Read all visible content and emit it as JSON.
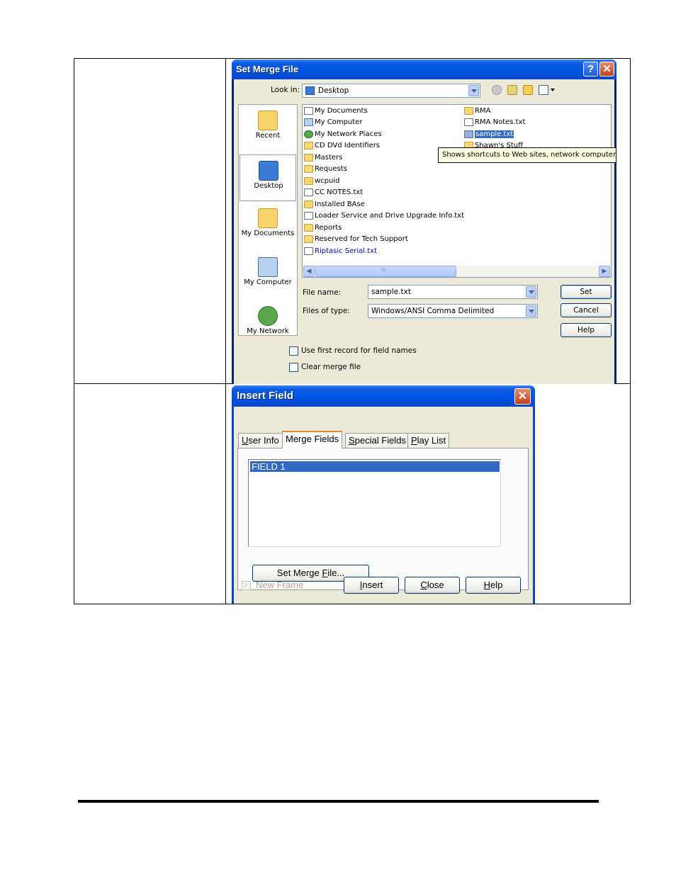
{
  "set_merge_file": {
    "title": "Set Merge File",
    "look_in_label": "Look in:",
    "look_in_value": "Desktop",
    "places": [
      {
        "label": "Recent",
        "icon": "recent-folder-icon"
      },
      {
        "label": "Desktop",
        "icon": "desktop-icon"
      },
      {
        "label": "My Documents",
        "icon": "my-documents-icon"
      },
      {
        "label": "My Computer",
        "icon": "my-computer-icon"
      },
      {
        "label": "My Network",
        "icon": "my-network-icon"
      }
    ],
    "files_col1": [
      {
        "name": "My Documents",
        "icon": "doc"
      },
      {
        "name": "My Computer",
        "icon": "pc"
      },
      {
        "name": "My Network Places",
        "icon": "net"
      },
      {
        "name": "CD DVd Identifiers",
        "icon": "folder"
      },
      {
        "name": "Masters",
        "icon": "folder"
      },
      {
        "name": "Requests",
        "icon": "folder"
      },
      {
        "name": "wcpuid",
        "icon": "folder"
      },
      {
        "name": "CC NOTES.txt",
        "icon": "doc"
      },
      {
        "name": "Installed BAse",
        "icon": "shortcut"
      },
      {
        "name": "Loader Service and Drive Upgrade Info.txt",
        "icon": "doc"
      },
      {
        "name": "Reports",
        "icon": "shortcut"
      },
      {
        "name": "Reserved for Tech Support",
        "icon": "shortcut"
      },
      {
        "name": "Riptasic Serial.txt",
        "icon": "doc"
      }
    ],
    "files_col2": [
      {
        "name": "RMA",
        "icon": "shortcut"
      },
      {
        "name": "RMA Notes.txt",
        "icon": "doc"
      },
      {
        "name": "sample.txt",
        "icon": "doc"
      },
      {
        "name": "Shawn's Stuff",
        "icon": "shortcut"
      }
    ],
    "tooltip": "Shows shortcuts to Web sites, network computers, ar",
    "file_name_label": "File name:",
    "file_name_value": "sample.txt",
    "files_of_type_label": "Files of type:",
    "files_of_type_value": "Windows/ANSI Comma Delimited",
    "buttons": {
      "set": "Set",
      "cancel": "Cancel",
      "help": "Help"
    },
    "scroll_glyph": "III",
    "options": {
      "use_first_record": "Use first record for field names",
      "clear_merge_file": "Clear merge file"
    }
  },
  "insert_field": {
    "title": "Insert Field",
    "tabs": [
      {
        "label": "User Info",
        "mnemonic": "U",
        "rest": "ser Info"
      },
      {
        "label": "Merge Fields",
        "mnemonic": "",
        "rest": "Merge Fields"
      },
      {
        "label": "Special Fields",
        "mnemonic": "S",
        "rest": "pecial Fields"
      },
      {
        "label": "Play List",
        "mnemonic": "P",
        "rest": "lay List"
      }
    ],
    "fields": [
      "FIELD 1"
    ],
    "set_merge_file_button": {
      "before": "Set Merge ",
      "mnemonic": "F",
      "after": "ile..."
    },
    "new_frame_label": "New Frame",
    "buttons": {
      "insert": {
        "mnemonic": "I",
        "rest": "nsert"
      },
      "close": {
        "mnemonic": "C",
        "rest": "lose"
      },
      "help": {
        "mnemonic": "H",
        "rest": "elp"
      }
    }
  }
}
